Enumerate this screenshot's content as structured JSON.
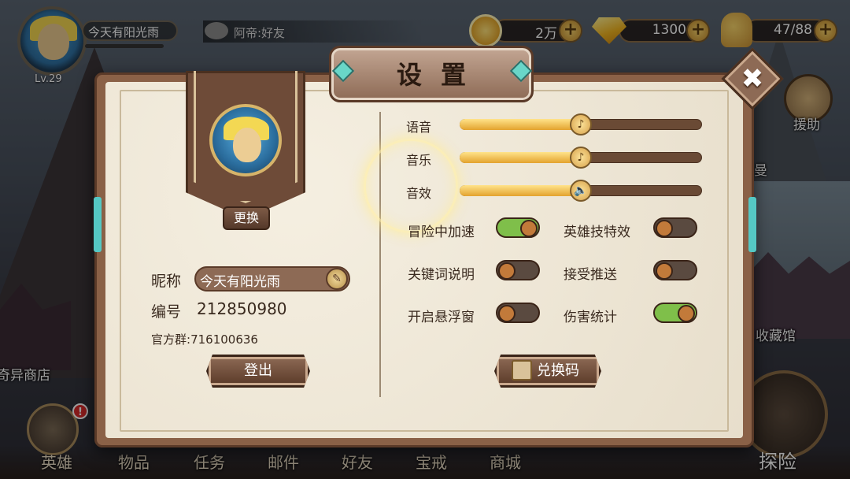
{
  "player": {
    "name": "今天有阳光雨",
    "level": "Lv.29"
  },
  "chat": {
    "text": "阿帝:好友"
  },
  "resources": {
    "gold": "2万",
    "diamond": "1300",
    "stamina": "47/88",
    "plus": "+"
  },
  "side": {
    "assist": "援助",
    "shop": "奇异商店",
    "collection": "收藏馆",
    "hidden_right": "曼"
  },
  "bottom_nav": {
    "hero": "英雄",
    "items": "物品",
    "tasks": "任务",
    "mail": "邮件",
    "friends": "好友",
    "ring": "宝戒",
    "store": "商城",
    "explore": "探险",
    "hero_badge": "!"
  },
  "settings": {
    "title": "设置",
    "close": "✖",
    "change_label": "更换",
    "nickname_label": "昵称",
    "nickname_value": "今天有阳光雨",
    "id_label": "编号",
    "id_value": "212850980",
    "group_label": "官方群:",
    "group_value": "716100636",
    "logout_label": "登出",
    "redeem_label": "兑换码",
    "sliders": [
      {
        "label": "语音",
        "level": 0.5,
        "icon": "music-note-icon",
        "glyph": "♪"
      },
      {
        "label": "音乐",
        "level": 0.5,
        "icon": "music-note-icon",
        "glyph": "♪"
      },
      {
        "label": "音效",
        "level": 0.5,
        "icon": "speaker-icon",
        "glyph": "🔈"
      }
    ],
    "toggles": [
      {
        "label": "冒险中加速",
        "on": true
      },
      {
        "label": "英雄技特效",
        "on": false
      },
      {
        "label": "关键词说明",
        "on": false
      },
      {
        "label": "接受推送",
        "on": false
      },
      {
        "label": "开启悬浮窗",
        "on": false
      },
      {
        "label": "伤害统计",
        "on": true
      }
    ]
  },
  "colors": {
    "panel_frame": "#8a6147",
    "panel_bg": "#efe8d8",
    "toggle_on": "#7fbf4a",
    "toggle_off": "#5a4a40",
    "slider_fill": "#e3a32e"
  }
}
